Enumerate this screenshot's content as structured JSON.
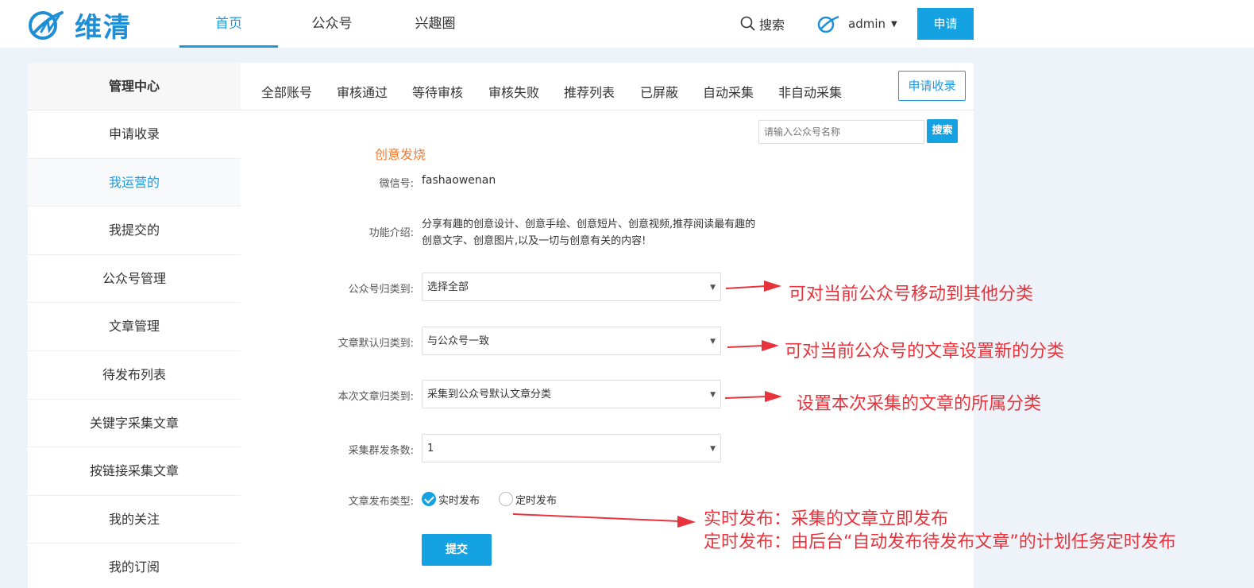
{
  "header": {
    "logo_text": "维清",
    "nav": [
      {
        "label": "首页",
        "active": true
      },
      {
        "label": "公众号",
        "active": false
      },
      {
        "label": "兴趣圈",
        "active": false
      }
    ],
    "search_label": "搜索",
    "user_name": "admin",
    "apply_label": "申请"
  },
  "sidebar": {
    "title": "管理中心",
    "items": [
      {
        "label": "申请收录"
      },
      {
        "label": "我运营的",
        "active": true
      },
      {
        "label": "我提交的"
      },
      {
        "label": "公众号管理"
      },
      {
        "label": "文章管理"
      },
      {
        "label": "待发布列表"
      },
      {
        "label": "关键字采集文章"
      },
      {
        "label": "按链接采集文章"
      },
      {
        "label": "我的关注"
      },
      {
        "label": "我的订阅"
      }
    ]
  },
  "tabs": [
    "全部账号",
    "审核通过",
    "等待审核",
    "审核失败",
    "推荐列表",
    "已屏蔽",
    "自动采集",
    "非自动采集"
  ],
  "apply_collect_label": "申请收录",
  "search": {
    "placeholder": "请输入公众号名称",
    "button": "搜索"
  },
  "form": {
    "account_name": "创意发烧",
    "wechat_label": "微信号:",
    "wechat_value": "fashaowenan",
    "intro_label": "功能介绍:",
    "intro_value": "分享有趣的创意设计、创意手绘、创意短片、创意视频,推荐阅读最有趣的创意文字、创意图片,以及一切与创意有关的内容!",
    "category_label": "公众号归类到:",
    "category_value": "选择全部",
    "article_default_label": "文章默认归类到:",
    "article_default_value": "与公众号一致",
    "article_this_label": "本次文章归类到:",
    "article_this_value": "采集到公众号默认文章分类",
    "count_label": "采集群发条数:",
    "count_value": "1",
    "publish_type_label": "文章发布类型:",
    "publish_options": [
      {
        "label": "实时发布",
        "checked": true
      },
      {
        "label": "定时发布",
        "checked": false
      }
    ],
    "submit_label": "提交"
  },
  "annotations": {
    "note1": "可对当前公众号移动到其他分类",
    "note2": "可对当前公众号的文章设置新的分类",
    "note3": "设置本次采集的文章的所属分类",
    "note4_line1": "实时发布：采集的文章立即发布",
    "note4_line2": "定时发布：由后台“自动发布待发布文章”的计划任务定时发布",
    "color": "#e8333c"
  },
  "colors": {
    "accent": "#14a2e2",
    "highlight": "#f07b32"
  }
}
